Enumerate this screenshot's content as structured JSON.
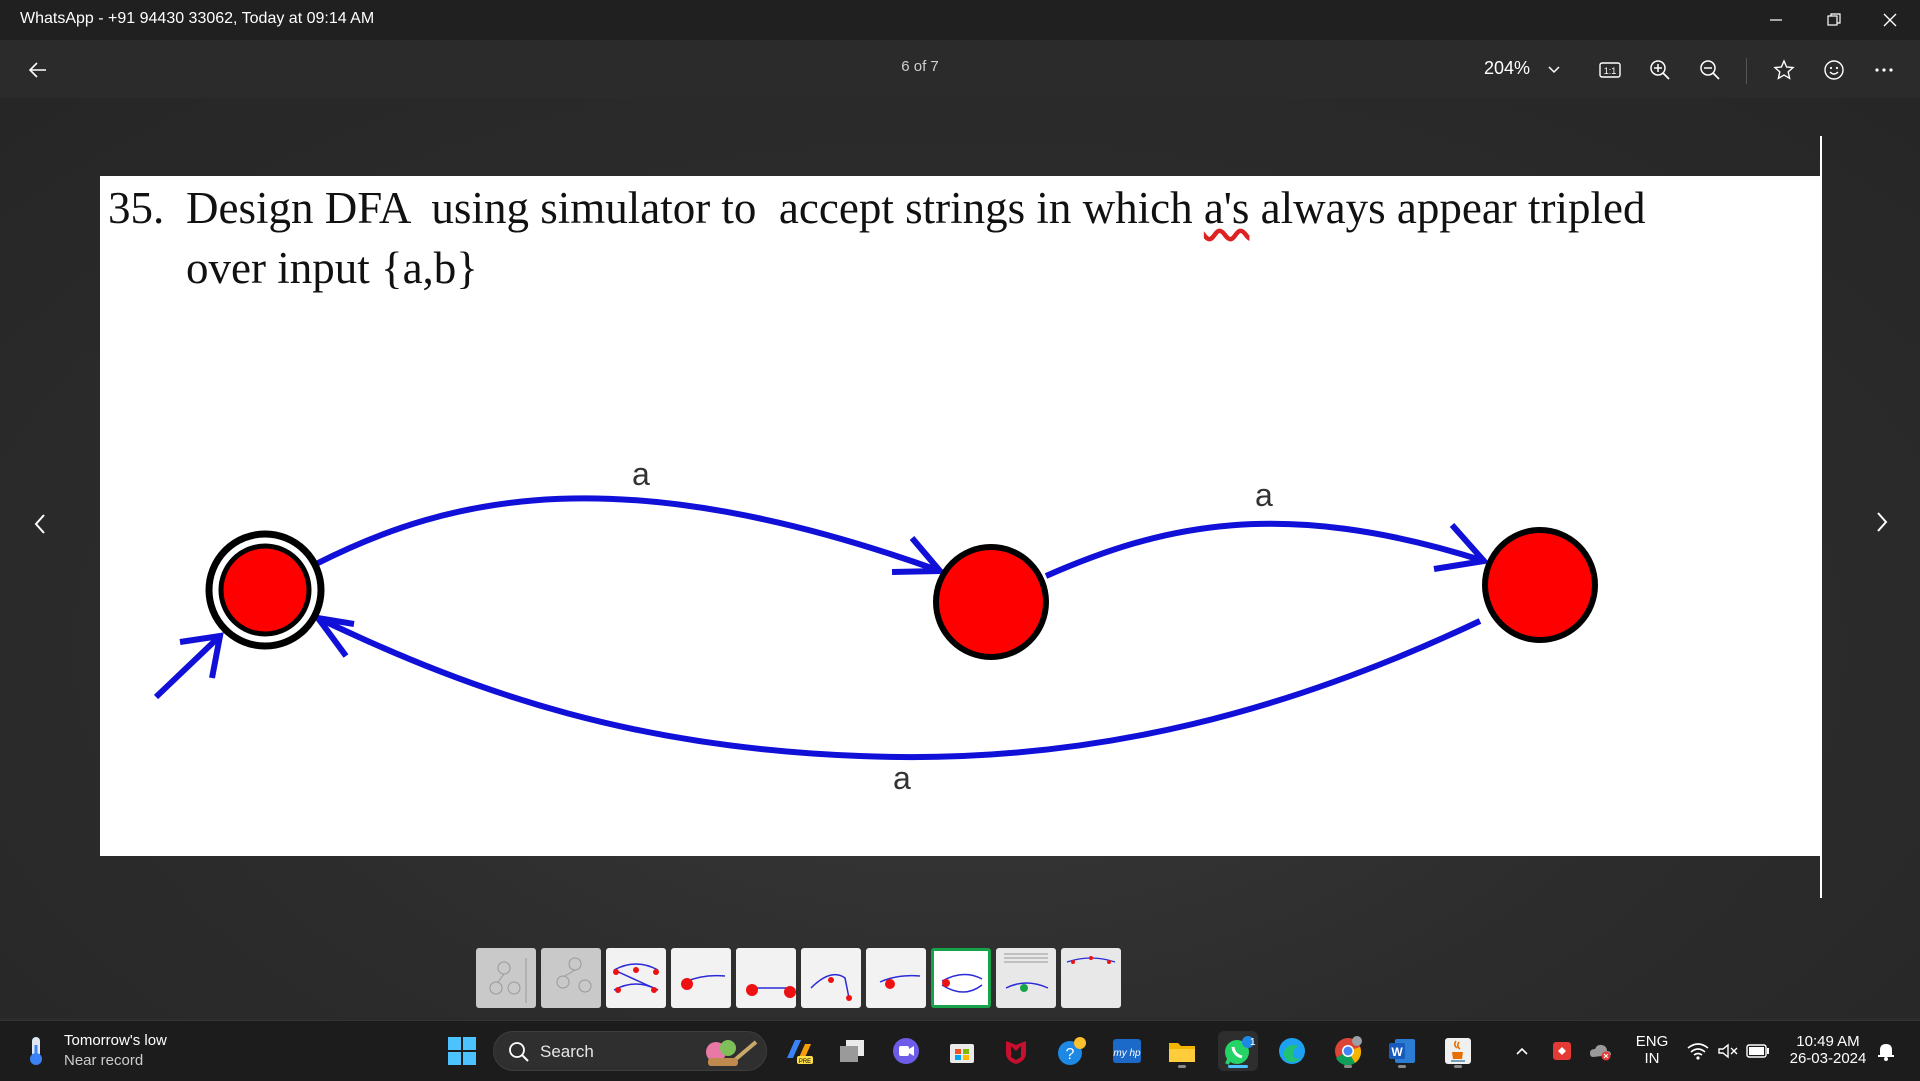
{
  "window": {
    "title": "WhatsApp - +91 94430 33062, Today at 09:14 AM"
  },
  "toolbar": {
    "page_counter": "6 of 7",
    "zoom_level": "204%"
  },
  "document": {
    "question_number": "35.",
    "heading_line1_a": "Design DFA  using simulator to  accept strings in which ",
    "heading_line1_word": "a's",
    "heading_line1_b": " always appear tripled",
    "heading_line2": "over input {a,b}"
  },
  "diagram": {
    "edge_labels": {
      "q0_q1": "a",
      "q1_q2": "a",
      "q2_q0": "a"
    },
    "colors": {
      "state_fill": "#ff0000",
      "edge_color": "#1010d8"
    }
  },
  "filmstrip": {
    "count": 10,
    "active_index": 7
  },
  "taskbar": {
    "weather_main": "Tomorrow's low",
    "weather_sub": "Near record",
    "search_label": "Search",
    "whatsapp_badge": "1",
    "lang_primary": "ENG",
    "lang_secondary": "IN",
    "time": "10:49 AM",
    "date": "26-03-2024"
  }
}
